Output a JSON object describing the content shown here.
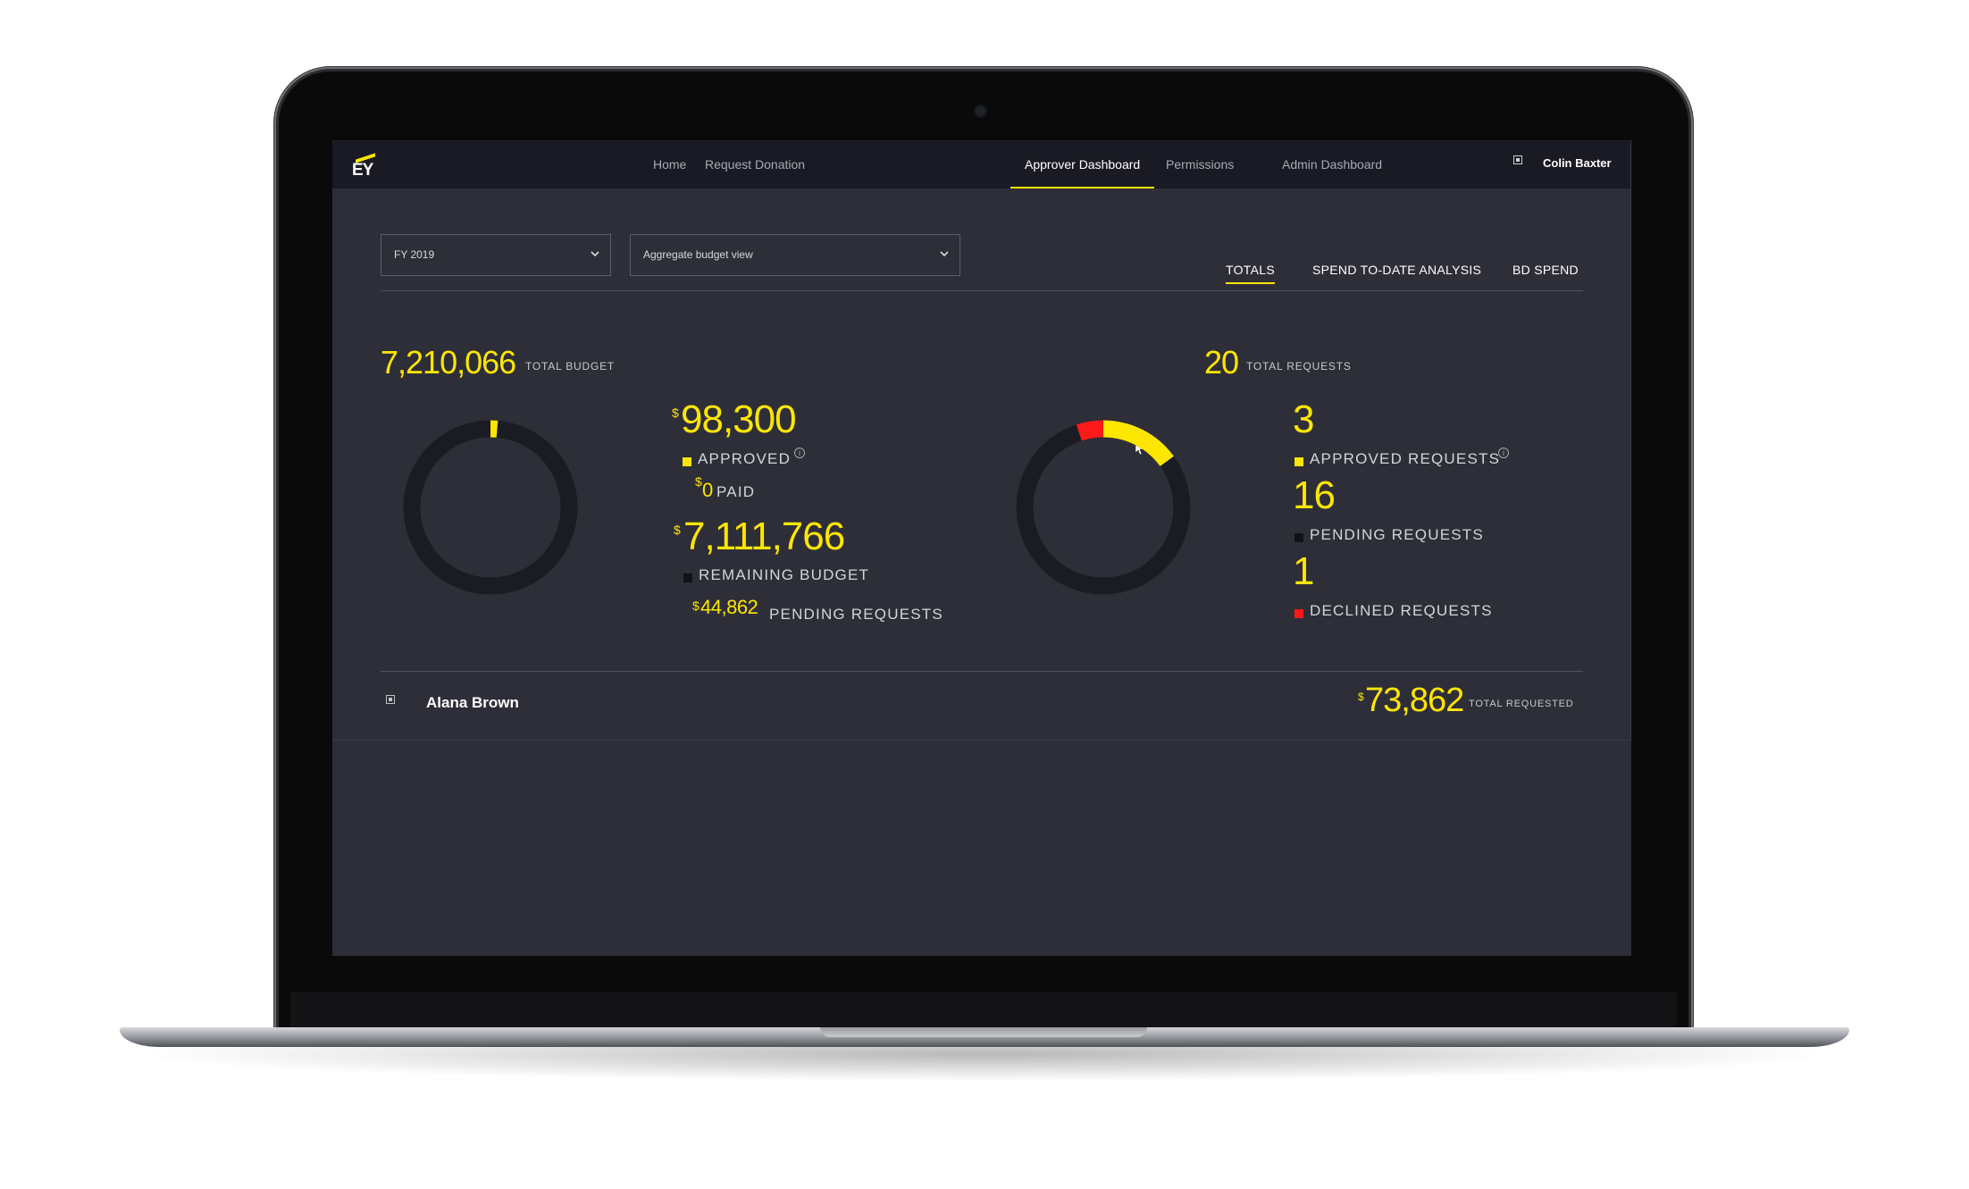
{
  "colors": {
    "accent": "#ffe600",
    "declined": "#ff1a1a",
    "pending": "#111118",
    "background": "#2e2e38",
    "navbar": "#1a1a24"
  },
  "nav": {
    "logo": "EY",
    "items": [
      "Home",
      "Request Donation",
      "Approver Dashboard",
      "Permissions",
      "Admin Dashboard"
    ],
    "active": "Approver Dashboard",
    "user_name": "Colin Baxter",
    "user_icon": "broken-image-icon"
  },
  "filters": {
    "year": {
      "value": "FY 2019"
    },
    "view": {
      "value": "Aggregate budget view"
    }
  },
  "tabs": {
    "totals": "TOTALS",
    "spend": "SPEND TO-DATE ANALYSIS",
    "bd": "BD SPEND",
    "active": "TOTALS"
  },
  "budget": {
    "total": "7,210,066",
    "total_label": "TOTAL BUDGET",
    "currency": "$",
    "approved": "98,300",
    "approved_label": "APPROVED",
    "paid": "0",
    "paid_label": "PAID",
    "remaining": "7,111,766",
    "remaining_label": "REMAINING BUDGET",
    "pending": "44,862",
    "pending_label": "PENDING REQUESTS",
    "approved_fraction": 0.0136
  },
  "requests": {
    "total": "20",
    "total_label": "TOTAL REQUESTS",
    "approved": "3",
    "approved_label": "APPROVED REQUESTS",
    "pending": "16",
    "pending_label": "PENDING REQUESTS",
    "declined": "1",
    "declined_label": "DECLINED REQUESTS"
  },
  "people": [
    {
      "name": "Alana Brown",
      "amount": "73,862",
      "amount_label": "TOTAL REQUESTED",
      "currency": "$"
    }
  ]
}
